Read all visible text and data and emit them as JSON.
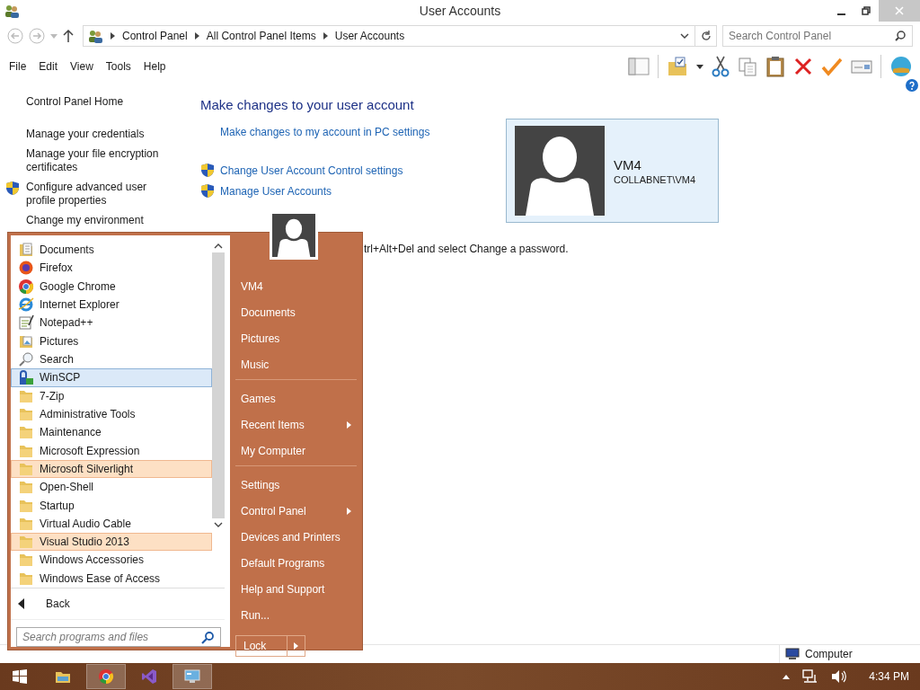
{
  "window": {
    "title": "User Accounts"
  },
  "address_bar": {
    "breadcrumbs": [
      "Control Panel",
      "All Control Panel Items",
      "User Accounts"
    ]
  },
  "search": {
    "placeholder": "Search Control Panel"
  },
  "menu_bar": [
    "File",
    "Edit",
    "View",
    "Tools",
    "Help"
  ],
  "sidebar": {
    "items": [
      {
        "label": "Control Panel Home",
        "kind": "plain"
      },
      {
        "label": "Manage your credentials",
        "kind": "plain"
      },
      {
        "label": "Manage your file encryption certificates",
        "kind": "plain"
      },
      {
        "label": "Configure advanced user profile properties",
        "kind": "shield"
      },
      {
        "label": "Change my environment",
        "kind": "plain"
      }
    ]
  },
  "main": {
    "heading": "Make changes to your user account",
    "links": [
      {
        "label": "Make changes to my account in PC settings",
        "kind": "plain"
      },
      {
        "label": "Change User Account Control settings",
        "kind": "shield"
      },
      {
        "label": "Manage User Accounts",
        "kind": "shield"
      }
    ],
    "note": "trl+Alt+Del and select Change a password.",
    "account": {
      "name": "VM4",
      "domain": "COLLABNET\\VM4"
    }
  },
  "status_bar": {
    "location": "Computer"
  },
  "start_menu": {
    "programs": [
      {
        "label": "Documents",
        "kind": "documents",
        "selected": false,
        "highlighted": false
      },
      {
        "label": "Firefox",
        "kind": "firefox",
        "selected": false,
        "highlighted": false
      },
      {
        "label": "Google Chrome",
        "kind": "chrome",
        "selected": false,
        "highlighted": false
      },
      {
        "label": "Internet Explorer",
        "kind": "ie",
        "selected": false,
        "highlighted": false
      },
      {
        "label": "Notepad++",
        "kind": "notepad",
        "selected": false,
        "highlighted": false
      },
      {
        "label": "Pictures",
        "kind": "pictures",
        "selected": false,
        "highlighted": false
      },
      {
        "label": "Search",
        "kind": "search",
        "selected": false,
        "highlighted": false
      },
      {
        "label": "WinSCP",
        "kind": "winscp",
        "selected": true,
        "highlighted": false
      },
      {
        "label": "7-Zip",
        "kind": "folder",
        "selected": false,
        "highlighted": false
      },
      {
        "label": "Administrative Tools",
        "kind": "folder",
        "selected": false,
        "highlighted": false
      },
      {
        "label": "Maintenance",
        "kind": "folder",
        "selected": false,
        "highlighted": false
      },
      {
        "label": "Microsoft Expression",
        "kind": "folder",
        "selected": false,
        "highlighted": false
      },
      {
        "label": "Microsoft Silverlight",
        "kind": "folder",
        "selected": false,
        "highlighted": true
      },
      {
        "label": "Open-Shell",
        "kind": "folder",
        "selected": false,
        "highlighted": false
      },
      {
        "label": "Startup",
        "kind": "folder",
        "selected": false,
        "highlighted": false
      },
      {
        "label": "Virtual Audio Cable",
        "kind": "folder",
        "selected": false,
        "highlighted": false
      },
      {
        "label": "Visual Studio 2013",
        "kind": "folder",
        "selected": false,
        "highlighted": true
      },
      {
        "label": "Windows Accessories",
        "kind": "folder",
        "selected": false,
        "highlighted": false
      },
      {
        "label": "Windows Ease of Access",
        "kind": "folder",
        "selected": false,
        "highlighted": false
      }
    ],
    "back": "Back",
    "search": {
      "placeholder": "Search programs and files"
    },
    "sections": [
      {
        "items": [
          {
            "label": "VM4",
            "submenu": false
          },
          {
            "label": "Documents",
            "submenu": false
          },
          {
            "label": "Pictures",
            "submenu": false
          },
          {
            "label": "Music",
            "submenu": false
          }
        ]
      },
      {
        "items": [
          {
            "label": "Games",
            "submenu": false
          },
          {
            "label": "Recent Items",
            "submenu": true
          },
          {
            "label": "My Computer",
            "submenu": false
          }
        ]
      },
      {
        "items": [
          {
            "label": "Settings",
            "submenu": false
          },
          {
            "label": "Control Panel",
            "submenu": true
          },
          {
            "label": "Devices and Printers",
            "submenu": false
          },
          {
            "label": "Default Programs",
            "submenu": false
          },
          {
            "label": "Help and Support",
            "submenu": false
          },
          {
            "label": "Run...",
            "submenu": false
          }
        ]
      }
    ],
    "lock": "Lock"
  },
  "taskbar": {
    "apps": [
      {
        "kind": "explorer",
        "active": false
      },
      {
        "kind": "chrome",
        "active": true
      },
      {
        "kind": "studio",
        "active": false
      },
      {
        "kind": "control-panel",
        "active": true
      }
    ],
    "clock": "4:34 PM"
  }
}
